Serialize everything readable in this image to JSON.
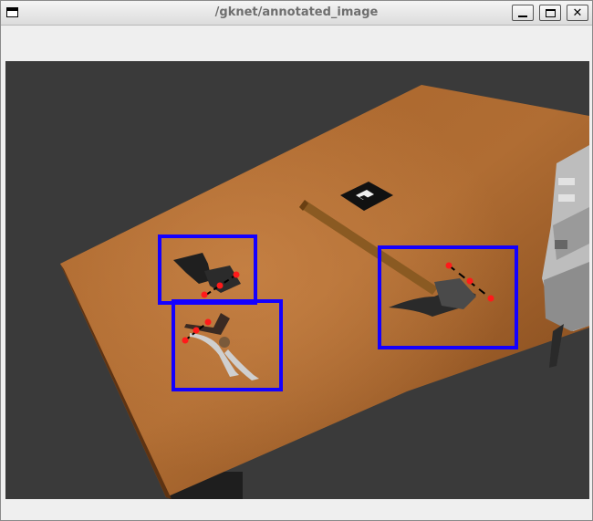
{
  "window": {
    "title": "/gknet/annotated_image"
  },
  "controls": {
    "minimize_icon": "minimize-icon",
    "maximize_icon": "maximize-icon",
    "close_glyph": "✕"
  },
  "scene": {
    "marker_color": "#ff1a1a",
    "box_color": "#1400ff",
    "detections": [
      {
        "object": "putty knife"
      },
      {
        "object": "pliers"
      },
      {
        "object": "hammer"
      }
    ]
  }
}
